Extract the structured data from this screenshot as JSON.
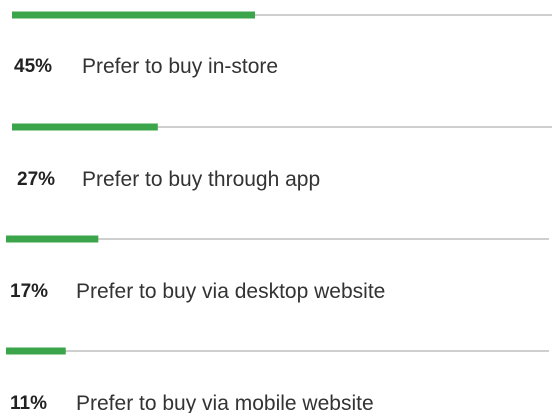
{
  "chart_data": {
    "type": "bar",
    "orientation": "horizontal",
    "unit": "%",
    "xlim": [
      0,
      100
    ],
    "grid": false,
    "legend": "none",
    "categories": [
      "Prefer to buy in-store",
      "Prefer to buy through app",
      "Prefer to buy via desktop website",
      "Prefer to buy via mobile website"
    ],
    "values": [
      45,
      27,
      17,
      11
    ],
    "labels": [
      "45%",
      "27%",
      "17%",
      "11%"
    ],
    "colors": {
      "bar": "#3aa54a",
      "track": "#cfcfcf",
      "percent_text": "#222222",
      "label_text": "#333333"
    }
  }
}
